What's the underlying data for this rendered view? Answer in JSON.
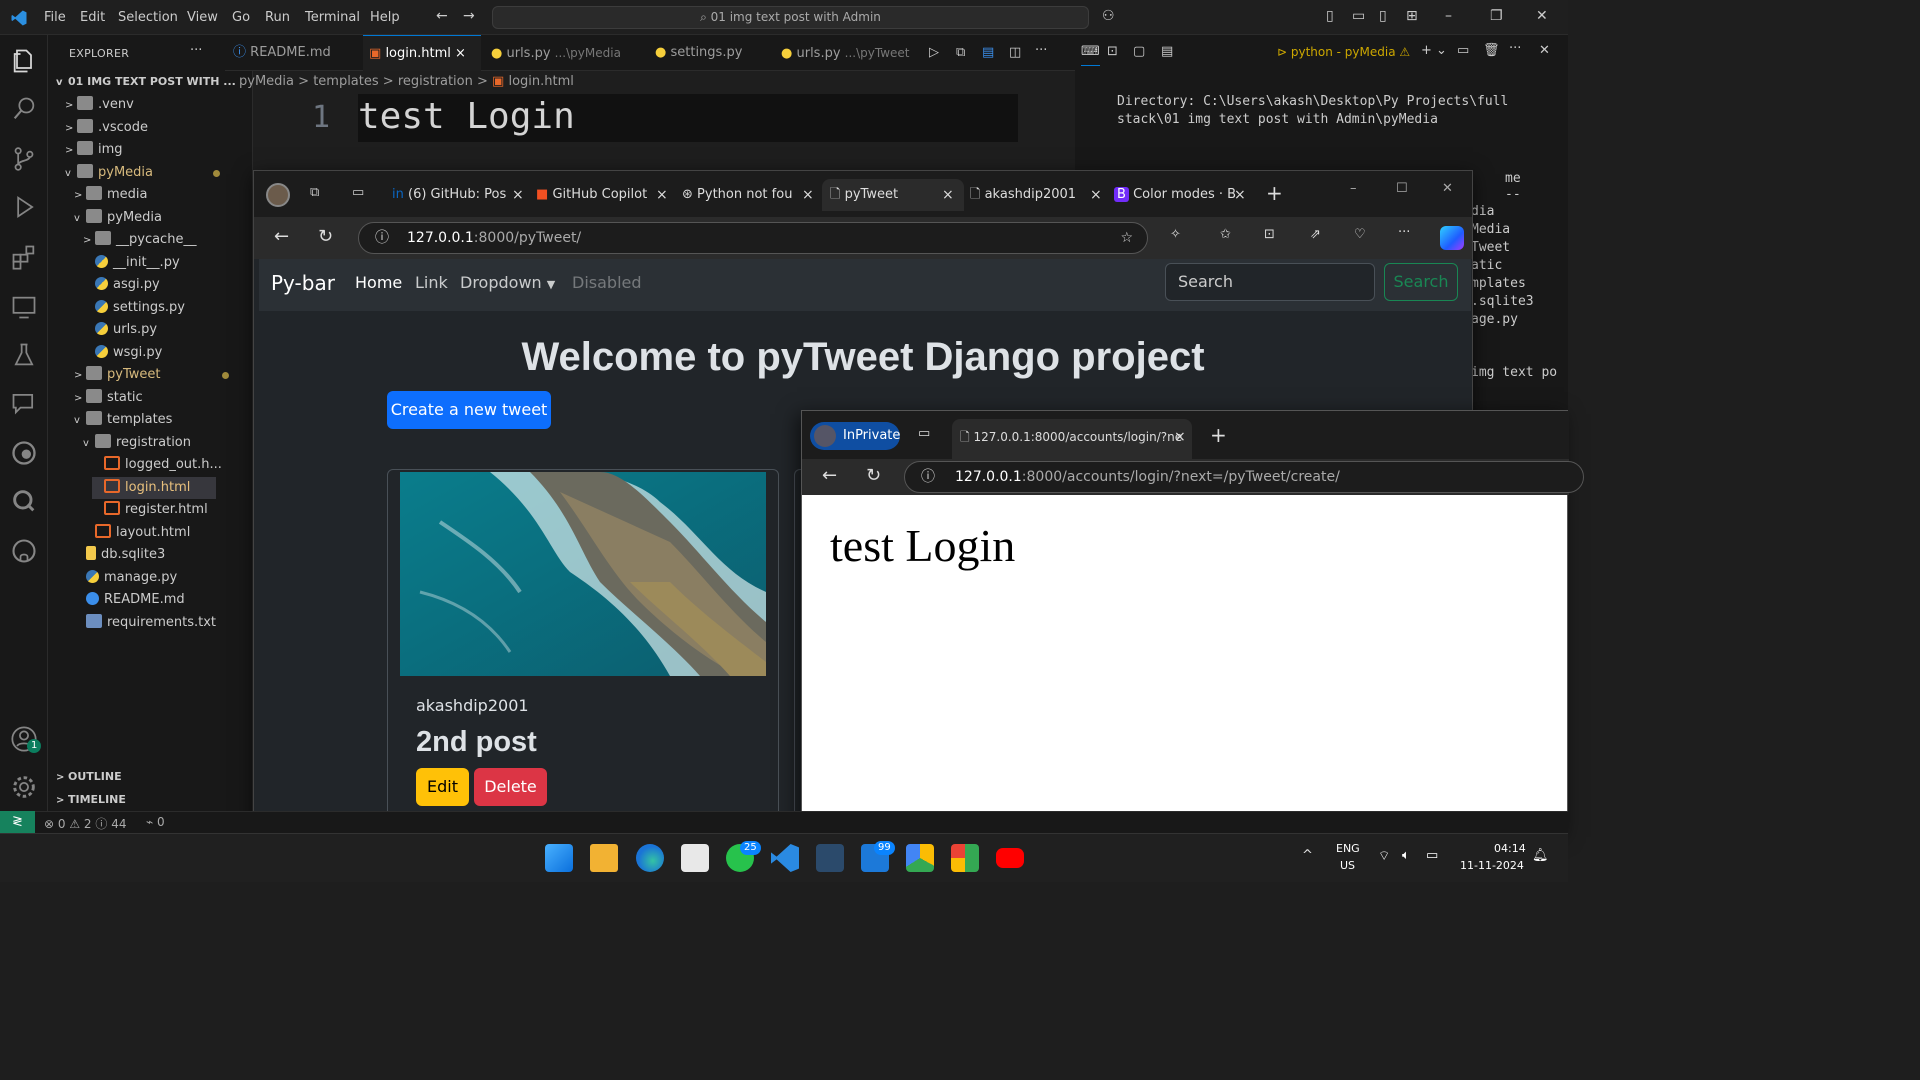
{
  "vscode": {
    "menu": [
      "File",
      "Edit",
      "Selection",
      "View",
      "Go",
      "Run",
      "Terminal",
      "Help"
    ],
    "command_center": "01 img text post with Admin",
    "explorer_title": "EXPLORER",
    "workspace": "01 IMG TEXT POST WITH ...",
    "tree": [
      {
        "label": ".venv",
        "depth": 1,
        "kind": "folder",
        "chevron": ">"
      },
      {
        "label": ".vscode",
        "depth": 1,
        "kind": "folder",
        "chevron": ">"
      },
      {
        "label": "img",
        "depth": 1,
        "kind": "folder",
        "chevron": ">"
      },
      {
        "label": "pyMedia",
        "depth": 1,
        "kind": "folder",
        "chevron": "v",
        "dot": true
      },
      {
        "label": "media",
        "depth": 2,
        "kind": "folder",
        "chevron": ">"
      },
      {
        "label": "pyMedia",
        "depth": 2,
        "kind": "folder",
        "chevron": "v"
      },
      {
        "label": "__pycache__",
        "depth": 3,
        "kind": "folder",
        "chevron": ">"
      },
      {
        "label": "__init__.py",
        "depth": 3,
        "kind": "py"
      },
      {
        "label": "asgi.py",
        "depth": 3,
        "kind": "py"
      },
      {
        "label": "settings.py",
        "depth": 3,
        "kind": "py"
      },
      {
        "label": "urls.py",
        "depth": 3,
        "kind": "py"
      },
      {
        "label": "wsgi.py",
        "depth": 3,
        "kind": "py"
      },
      {
        "label": "pyTweet",
        "depth": 2,
        "kind": "folder",
        "chevron": ">",
        "dot": true
      },
      {
        "label": "static",
        "depth": 2,
        "kind": "folder",
        "chevron": ">"
      },
      {
        "label": "templates",
        "depth": 2,
        "kind": "folder",
        "chevron": "v"
      },
      {
        "label": "registration",
        "depth": 3,
        "kind": "folder",
        "chevron": "v"
      },
      {
        "label": "logged_out.h...",
        "depth": 4,
        "kind": "html"
      },
      {
        "label": "login.html",
        "depth": 4,
        "kind": "html",
        "selected": true
      },
      {
        "label": "register.html",
        "depth": 4,
        "kind": "html"
      },
      {
        "label": "layout.html",
        "depth": 3,
        "kind": "html"
      },
      {
        "label": "db.sqlite3",
        "depth": 2,
        "kind": "db"
      },
      {
        "label": "manage.py",
        "depth": 2,
        "kind": "py"
      },
      {
        "label": "README.md",
        "depth": 2,
        "kind": "info"
      },
      {
        "label": "requirements.txt",
        "depth": 2,
        "kind": "txt"
      }
    ],
    "outline": "OUTLINE",
    "timeline": "TIMELINE",
    "editor_tabs": [
      {
        "label": "README.md",
        "suffix": ""
      },
      {
        "label": "login.html",
        "suffix": "",
        "active": true
      },
      {
        "label": "urls.py",
        "suffix": "...\\pyMedia"
      },
      {
        "label": "settings.py",
        "suffix": ""
      },
      {
        "label": "urls.py",
        "suffix": "...\\pyTweet"
      }
    ],
    "breadcrumb": [
      "pyMedia",
      ">",
      "templates",
      ">",
      "registration",
      ">",
      "login.html"
    ],
    "line_number": "1",
    "code_line": "test Login",
    "terminal_tab": "python - pyMedia",
    "terminal_lines": [
      "Directory: C:\\Users\\akash\\Desktop\\Py Projects\\full",
      "stack\\01 img text post with Admin\\pyMedia"
    ],
    "terminal_partial": [
      "me",
      "--",
      "dia",
      "Media",
      "Tweet",
      "atic",
      "mplates",
      ".sqlite3",
      "age.py",
      "img text po"
    ],
    "status": {
      "errors": "0",
      "warnings": "2",
      "info": "44",
      "ports": "0"
    },
    "accounts_badge": "1"
  },
  "browser1": {
    "tabs": [
      {
        "label": "(6) GitHub: Pos"
      },
      {
        "label": "GitHub Copilot"
      },
      {
        "label": "Python not fou"
      },
      {
        "label": "pyTweet",
        "active": true
      },
      {
        "label": "akashdip2001"
      },
      {
        "label": "Color modes · B"
      }
    ],
    "url_host": "127.0.0.1",
    "url_rest": ":8000/pyTweet/",
    "navbar": {
      "brand": "Py-bar",
      "links": [
        "Home",
        "Link",
        "Dropdown",
        "Disabled"
      ],
      "search_placeholder": "Search",
      "search_button": "Search"
    },
    "heading": "Welcome to pyTweet Django project",
    "create_button": "Create a new tweet",
    "card": {
      "author": "akashdip2001",
      "title": "2nd post",
      "edit": "Edit",
      "delete": "Delete"
    }
  },
  "browser2": {
    "inprivate": "InPrivate",
    "tab_label": "127.0.0.1:8000/accounts/login/?ne",
    "url_host": "127.0.0.1",
    "url_rest": ":8000/accounts/login/?next=/pyTweet/create/",
    "page_text": "test Login"
  },
  "taskbar": {
    "whatsapp_badge": "25",
    "app_badge": "99",
    "lang": "ENG",
    "region": "US",
    "time": "04:14",
    "date": "11-11-2024"
  },
  "colors": {
    "bootstrap_primary": "#0d6efd",
    "bootstrap_warning": "#ffc107",
    "bootstrap_danger": "#dc3545",
    "vscode_accent": "#0078d4"
  }
}
